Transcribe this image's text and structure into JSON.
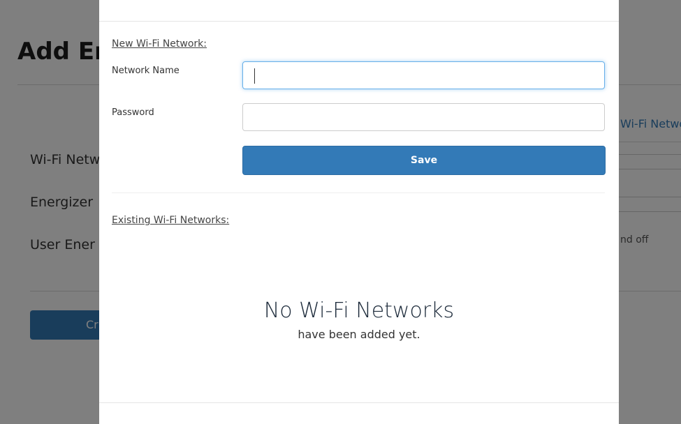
{
  "background": {
    "title": "Add En",
    "labels": [
      "Wi-Fi Netw",
      "Energizer",
      "User Ener"
    ],
    "create_button": "Cr",
    "right_link": "Wi-Fi Netwo",
    "right_text": "nd off"
  },
  "modal": {
    "new_section_heading": "New Wi-Fi Network:",
    "network_name_label": "Network Name",
    "network_name_value": "",
    "password_label": "Password",
    "password_value": "",
    "save_label": "Save",
    "existing_section_heading": "Existing Wi-Fi Networks:",
    "empty_title": "No Wi-Fi Networks",
    "empty_subtitle": "have been added yet."
  },
  "colors": {
    "primary": "#337ab7",
    "focus": "#66afe9",
    "overlay": "rgba(0,0,0,0.5)"
  }
}
